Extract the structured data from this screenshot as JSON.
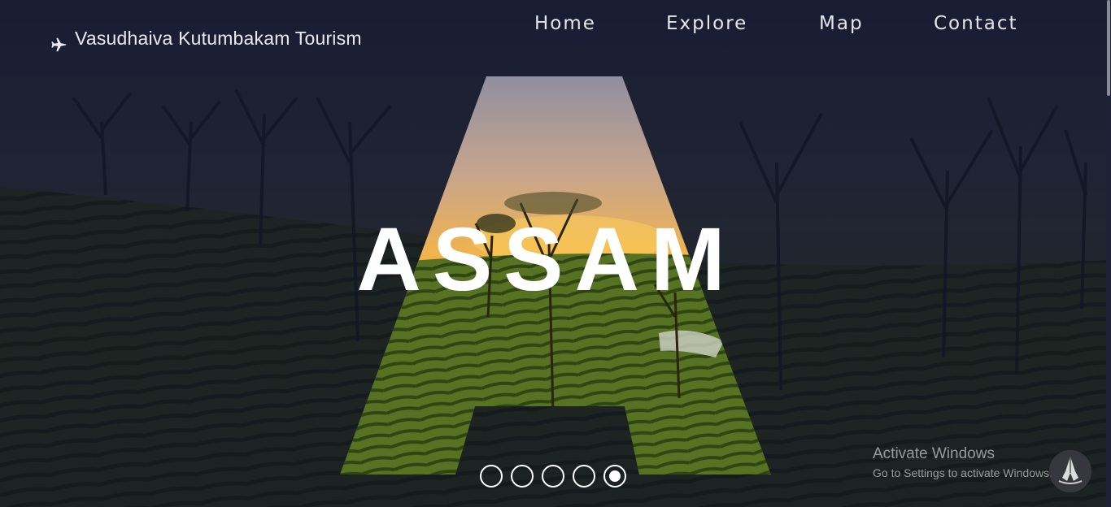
{
  "brand": {
    "title": "Vasudhaiva Kutumbakam Tourism",
    "icon": "airplane-icon"
  },
  "nav": {
    "items": [
      "Home",
      "Explore",
      "Map",
      "Contact"
    ]
  },
  "hero": {
    "headline": "ASSAM",
    "slide_count": 5,
    "active_slide": 5
  },
  "watermark": {
    "title": "Activate Windows",
    "subtitle": "Go to Settings to activate Windows."
  },
  "colors": {
    "overlay": "#151a2e",
    "sky": "#f2a93b",
    "tea": "#4e6b1e",
    "text": "#ffffff"
  },
  "chat_icon": "namaste-icon"
}
